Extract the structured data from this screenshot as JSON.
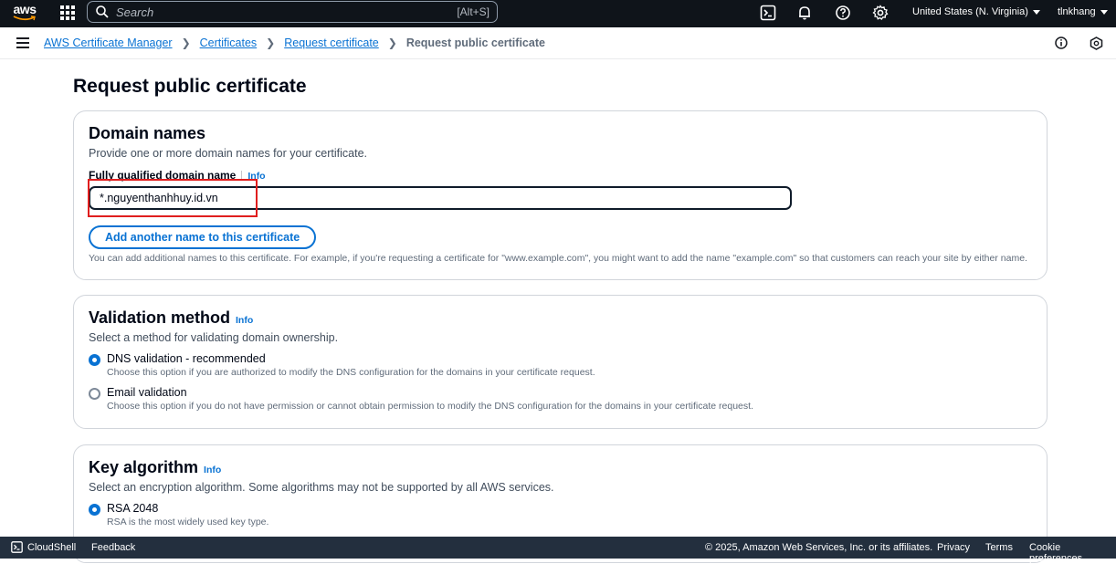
{
  "topnav": {
    "logo_text": "aws",
    "search_placeholder": "Search",
    "search_shortcut": "[Alt+S]",
    "region": "United States (N. Virginia)",
    "user": "tlnkhang"
  },
  "breadcrumb": {
    "items": [
      "AWS Certificate Manager",
      "Certificates",
      "Request certificate"
    ],
    "current": "Request public certificate"
  },
  "page": {
    "title": "Request public certificate"
  },
  "domain_names": {
    "title": "Domain names",
    "description": "Provide one or more domain names for your certificate.",
    "field_label": "Fully qualified domain name",
    "info": "Info",
    "value": "*.nguyenthanhhuy.id.vn",
    "add_button": "Add another name to this certificate",
    "help": "You can add additional names to this certificate. For example, if you're requesting a certificate for \"www.example.com\", you might want to add the name \"example.com\" so that customers can reach your site by either name."
  },
  "validation_method": {
    "title": "Validation method",
    "info": "Info",
    "description": "Select a method for validating domain ownership.",
    "options": [
      {
        "label": "DNS validation - recommended",
        "sub": "Choose this option if you are authorized to modify the DNS configuration for the domains in your certificate request.",
        "selected": true
      },
      {
        "label": "Email validation",
        "sub": "Choose this option if you do not have permission or cannot obtain permission to modify the DNS configuration for the domains in your certificate request.",
        "selected": false
      }
    ]
  },
  "key_algorithm": {
    "title": "Key algorithm",
    "info": "Info",
    "description": "Select an encryption algorithm. Some algorithms may not be supported by all AWS services.",
    "options": [
      {
        "label": "RSA 2048",
        "sub": "RSA is the most widely used key type.",
        "selected": true
      }
    ]
  },
  "footer": {
    "cloudshell": "CloudShell",
    "feedback": "Feedback",
    "copyright": "© 2025, Amazon Web Services, Inc. or its affiliates.",
    "privacy": "Privacy",
    "terms": "Terms",
    "cookie": "Cookie preferences"
  },
  "colors": {
    "accent": "#0972d3",
    "topnav_bg": "#0f141a",
    "footer_bg": "#232f3e",
    "highlight": "#e01e1e"
  }
}
